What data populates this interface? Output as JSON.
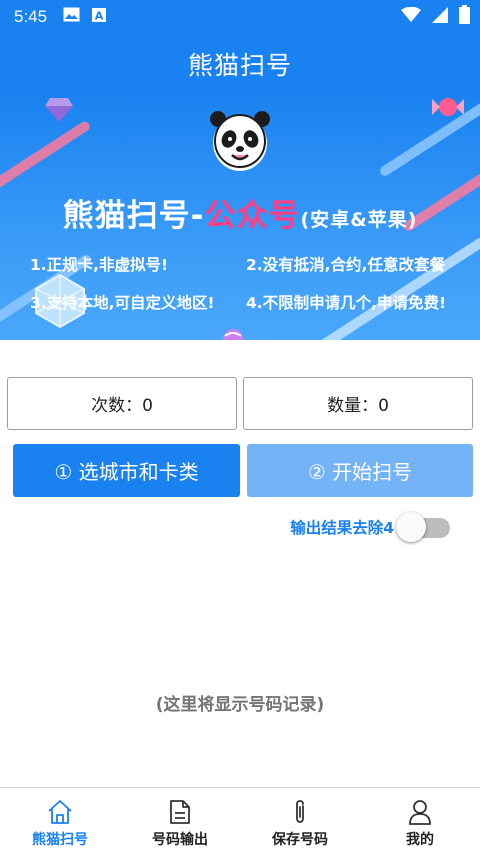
{
  "status_bar": {
    "time": "5:45",
    "icons": [
      "image-icon",
      "text-a-icon",
      "wifi-icon",
      "signal-icon",
      "battery-icon"
    ]
  },
  "app_bar": {
    "title": "熊猫扫号"
  },
  "banner": {
    "title_main": "熊猫扫号-",
    "title_accent": "公众号",
    "title_sub": "(安卓&苹果)",
    "features": [
      "1.正规卡,非虚拟号!",
      "2.没有抵消,合约,任意改套餐",
      "3.支持本地,可自定义地区!",
      "4.不限制申请几个,申请免费!"
    ]
  },
  "counters": {
    "times": "次数：0",
    "quantity": "数量：0"
  },
  "buttons": {
    "select": "① 选城市和卡类",
    "start": "② 开始扫号"
  },
  "toggle": {
    "label": "输出结果去除4",
    "on": false
  },
  "placeholder": "(这里将显示号码记录)",
  "bottom_nav": [
    {
      "label": "熊猫扫号",
      "icon": "home-icon",
      "active": true
    },
    {
      "label": "号码输出",
      "icon": "document-icon",
      "active": false
    },
    {
      "label": "保存号码",
      "icon": "paperclip-icon",
      "active": false
    },
    {
      "label": "我的",
      "icon": "user-icon",
      "active": false
    }
  ],
  "colors": {
    "primary": "#1a82f0",
    "disabled_button": "#74b3f5",
    "accent_pink": "#ff3f85"
  }
}
